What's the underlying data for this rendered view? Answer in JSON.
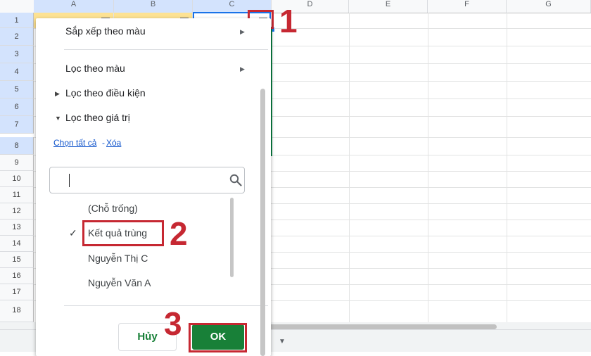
{
  "columns": [
    "A",
    "B",
    "C",
    "D",
    "E",
    "F",
    "G"
  ],
  "rows": [
    "1",
    "2",
    "3",
    "4",
    "5",
    "6",
    "7",
    "8",
    "9",
    "10",
    "11",
    "12",
    "13",
    "14",
    "15",
    "16",
    "17",
    "18"
  ],
  "menu": {
    "items": {
      "sort_by_color": "Sắp xếp theo màu",
      "filter_by_color": "Lọc theo màu",
      "filter_by_condition": "Lọc theo điều kiện",
      "filter_by_values": "Lọc theo giá trị"
    },
    "select_all": "Chọn tất cả",
    "separator": " - ",
    "clear": "Xóa",
    "search": {
      "value": "",
      "icon": "search-icon"
    },
    "values": [
      {
        "label": "(Chỗ trống)",
        "checked": false
      },
      {
        "label": "Kết quả trùng",
        "checked": true
      },
      {
        "label": "Nguyễn Thị C",
        "checked": false
      },
      {
        "label": "Nguyễn Văn A",
        "checked": false
      }
    ],
    "cancel_label": "Hủy",
    "ok_label": "OK"
  },
  "annotations": {
    "step1": "1",
    "step2": "2",
    "step3": "3"
  },
  "colors": {
    "header_fill": "#fde293",
    "accent_green": "#188038",
    "annotation_red": "#c62832",
    "selection_blue": "#1a73e8"
  }
}
